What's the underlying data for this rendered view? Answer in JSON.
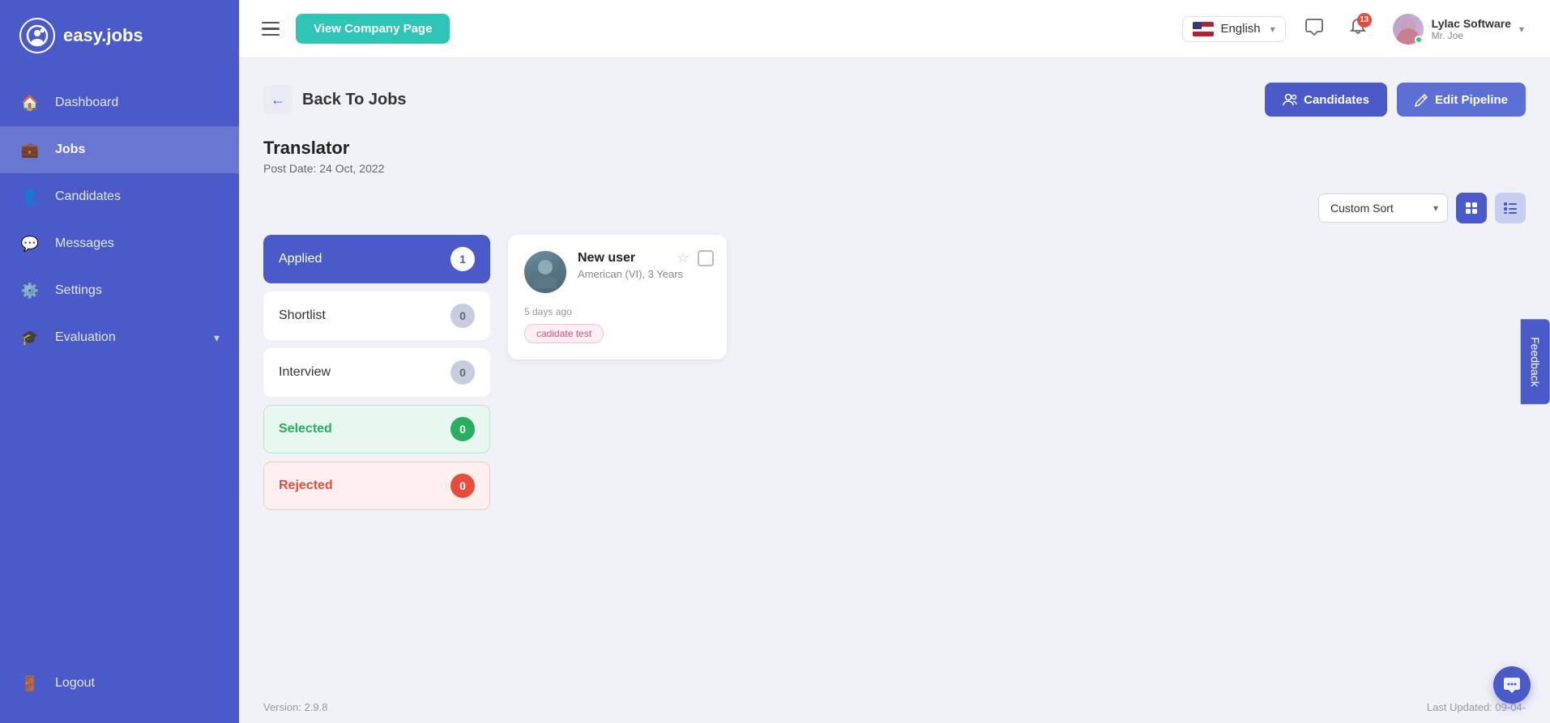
{
  "sidebar": {
    "logo_text": "easy.jobs",
    "items": [
      {
        "id": "dashboard",
        "label": "Dashboard",
        "icon": "🏠"
      },
      {
        "id": "jobs",
        "label": "Jobs",
        "icon": "💼",
        "active": true
      },
      {
        "id": "candidates",
        "label": "Candidates",
        "icon": "👤"
      },
      {
        "id": "messages",
        "label": "Messages",
        "icon": "💬"
      },
      {
        "id": "settings",
        "label": "Settings",
        "icon": "⚙️"
      },
      {
        "id": "evaluation",
        "label": "Evaluation",
        "icon": "🎓",
        "has_arrow": true
      }
    ],
    "logout_label": "Logout"
  },
  "header": {
    "view_company_btn": "View Company Page",
    "language": "English",
    "notification_count": "13",
    "company_name": "Lylac Software",
    "user_name": "Mr. Joe"
  },
  "page": {
    "back_label": "Back To Jobs",
    "candidates_btn": "Candidates",
    "edit_pipeline_btn": "Edit Pipeline",
    "job_title": "Translator",
    "post_date_label": "Post Date:",
    "post_date_value": "24 Oct, 2022",
    "sort_label": "Custom Sort",
    "stages": [
      {
        "id": "applied",
        "name": "Applied",
        "count": "1",
        "active": true
      },
      {
        "id": "shortlist",
        "name": "Shortlist",
        "count": "0"
      },
      {
        "id": "interview",
        "name": "Interview",
        "count": "0"
      },
      {
        "id": "selected",
        "name": "Selected",
        "count": "0",
        "type": "selected"
      },
      {
        "id": "rejected",
        "name": "Rejected",
        "count": "0",
        "type": "rejected"
      }
    ],
    "candidate": {
      "name": "New user",
      "meta": "American (VI), 3 Years",
      "date": "5 days ago",
      "tag": "cadidate test"
    },
    "version": "Version: 2.9.8",
    "last_updated": "Last Updated: 09-04-"
  },
  "feedback_label": "Feedback"
}
